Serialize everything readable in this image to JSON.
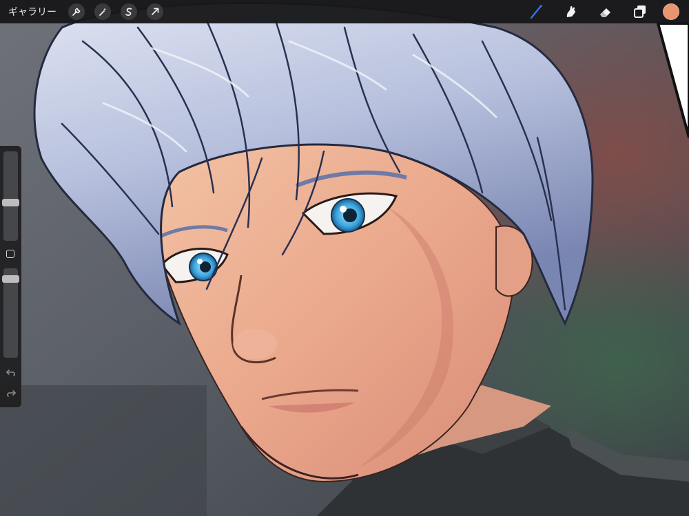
{
  "toolbar": {
    "gallery_label": "ギャラリー",
    "left_tools": [
      {
        "icon": "wrench-icon",
        "name": "actions"
      },
      {
        "icon": "magic-wand-icon",
        "name": "adjustments"
      },
      {
        "icon": "selection-icon",
        "name": "selection"
      },
      {
        "icon": "transform-arrow-icon",
        "name": "transform"
      }
    ],
    "right_tools": [
      {
        "icon": "brush-icon",
        "name": "paint",
        "active": true
      },
      {
        "icon": "smudge-icon",
        "name": "smudge"
      },
      {
        "icon": "eraser-icon",
        "name": "eraser"
      },
      {
        "icon": "layers-icon",
        "name": "layers"
      }
    ],
    "active_color": "#e8946e",
    "active_tool_color": "#2f7df6"
  },
  "sidebar": {
    "brush_size": 0.42,
    "brush_opacity": 0.92
  },
  "canvas": {
    "subject": "illustration-portrait"
  }
}
